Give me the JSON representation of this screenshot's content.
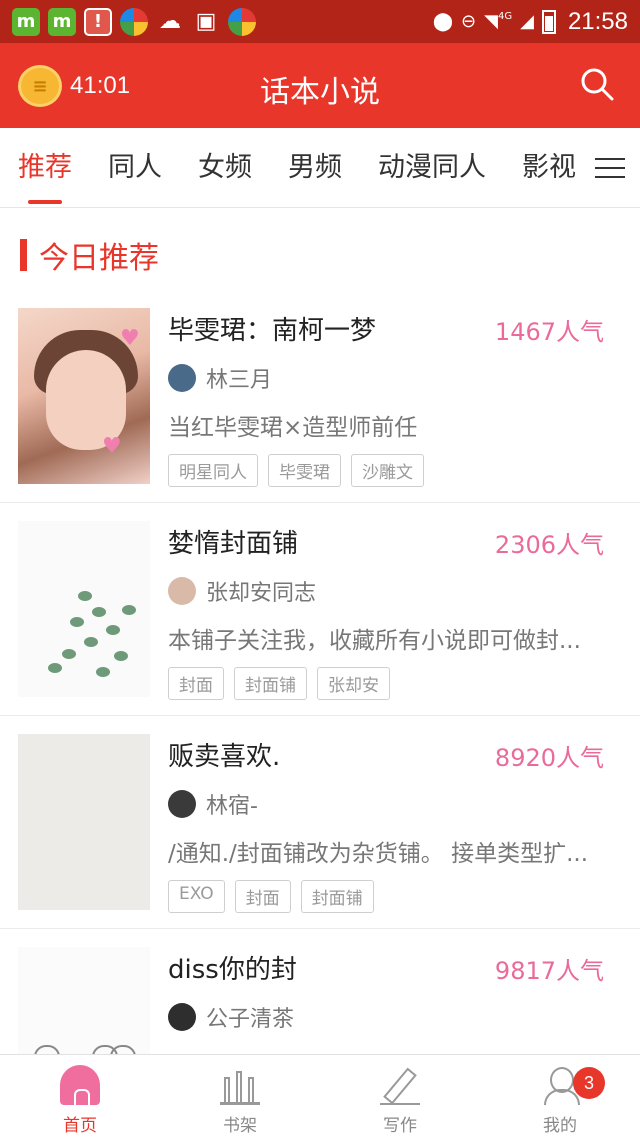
{
  "status_bar": {
    "time": "21:58",
    "network": "4G",
    "left_icons": [
      "m-app-icon",
      "m-app-icon",
      "phone-alert-icon",
      "color-app-icon",
      "cloud-download-icon",
      "image-icon",
      "color-app-icon"
    ],
    "right_icons": [
      "location-icon",
      "do-not-disturb-icon",
      "wifi-icon",
      "signal-icon",
      "battery-icon"
    ]
  },
  "app_bar": {
    "timer": "41:01",
    "title": "话本小说",
    "search_icon": "search-icon"
  },
  "tabs": [
    {
      "label": "推荐",
      "active": true
    },
    {
      "label": "同人",
      "active": false
    },
    {
      "label": "女频",
      "active": false
    },
    {
      "label": "男频",
      "active": false
    },
    {
      "label": "动漫同人",
      "active": false
    },
    {
      "label": "影视",
      "active": false
    }
  ],
  "section": {
    "title": "今日推荐"
  },
  "books": [
    {
      "title": "毕雯珺：南柯一梦",
      "popularity": "1467人气",
      "author": "林三月",
      "description": "当红毕雯珺×造型师前任",
      "tags": [
        "明星同人",
        "毕雯珺",
        "沙雕文"
      ]
    },
    {
      "title": "婪惰封面铺",
      "popularity": "2306人气",
      "author": "张却安同志",
      "description": "本铺子关注我，收藏所有小说即可做封...",
      "tags": [
        "封面",
        "封面铺",
        "张却安"
      ]
    },
    {
      "title": "贩卖喜欢.",
      "popularity": "8920人气",
      "author": "林宿-",
      "description": "/通知./封面铺改为杂货铺。 接单类型扩...",
      "tags": [
        "EXO",
        "封面",
        "封面铺"
      ]
    },
    {
      "title": "diss你的封",
      "popularity": "9817人气",
      "author": "公子清茶",
      "description": "",
      "tags": []
    }
  ],
  "bottom_nav": {
    "items": [
      {
        "label": "首页",
        "active": true
      },
      {
        "label": "书架",
        "active": false
      },
      {
        "label": "写作",
        "active": false
      },
      {
        "label": "我的",
        "active": false
      }
    ],
    "badge": "3"
  },
  "colors": {
    "brand": "#e8362b",
    "status_bar": "#b32418",
    "popularity": "#ea6b9a"
  }
}
